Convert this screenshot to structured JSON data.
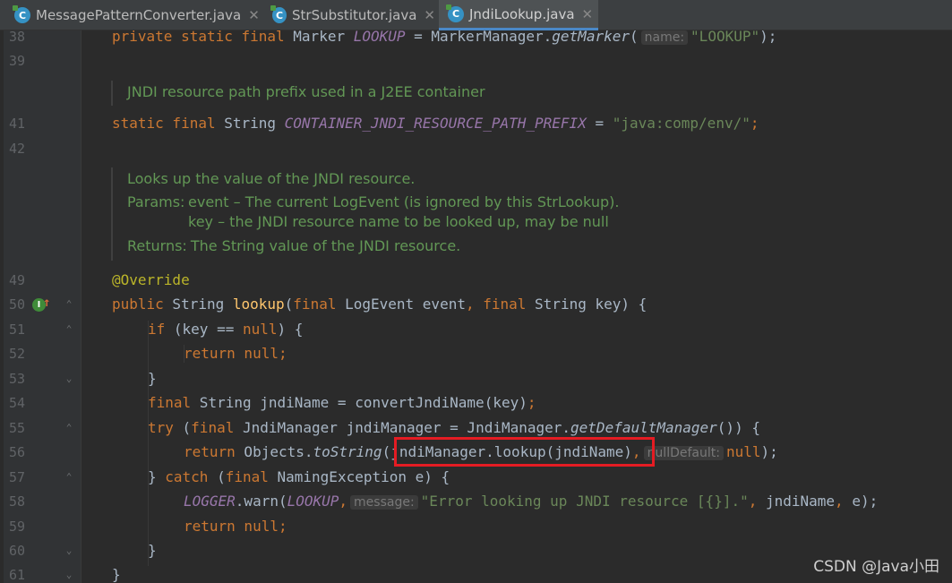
{
  "tabs": [
    {
      "label": "MessagePatternConverter.java",
      "icon": "java-class-icon",
      "active": false
    },
    {
      "label": "StrSubstitutor.java",
      "icon": "java-class-icon",
      "active": false
    },
    {
      "label": "JndiLookup.java",
      "icon": "java-class-icon",
      "active": true
    }
  ],
  "tab_icon_letter": "C",
  "close_glyph": "✕",
  "line_numbers": [
    "38",
    "39",
    "41",
    "42",
    "49",
    "50",
    "51",
    "52",
    "53",
    "54",
    "55",
    "56",
    "57",
    "58",
    "59",
    "60",
    "61"
  ],
  "doc1": "JNDI resource path prefix used in a J2EE container",
  "doc2": {
    "summary": "Looks up the value of the JNDI resource.",
    "params_label": "Params:",
    "param1": "event – The current LogEvent (is ignored by this StrLookup).",
    "param2": "key – the JNDI resource name to be looked up, may be null",
    "returns_label": "Returns:",
    "returns": "The String value of the JNDI resource."
  },
  "hints": {
    "name": "name:",
    "nullDefault": "nullDefault:",
    "message": "message:"
  },
  "code": {
    "l38_a": "private static final",
    "l38_b": " Marker ",
    "l38_c": "LOOKUP",
    "l38_d": " = MarkerManager.",
    "l38_e": "getMarker",
    "l38_f": "(",
    "l38_g": "\"LOOKUP\"",
    "l38_h": ");",
    "l41_a": "static final",
    "l41_b": " String ",
    "l41_c": "CONTAINER_JNDI_RESOURCE_PATH_PREFIX",
    "l41_d": " = ",
    "l41_e": "\"java:comp/env/\"",
    "l41_f": ";",
    "l49": "@Override",
    "l50_a": "public",
    "l50_b": " String ",
    "l50_c": "lookup",
    "l50_d": "(",
    "l50_e": "final",
    "l50_f": " LogEvent event",
    "l50_g": ", ",
    "l50_h": "final",
    "l50_i": " String key) {",
    "l51_a": "if",
    "l51_b": " (key == ",
    "l51_c": "null",
    "l51_d": ") {",
    "l52_a": "return null",
    "l52_b": ";",
    "l53": "}",
    "l54_a": "final",
    "l54_b": " String jndiName = convertJndiName(key)",
    "l54_c": ";",
    "l55_a": "try",
    "l55_b": " (",
    "l55_c": "final",
    "l55_d": " JndiManager jndiManager = JndiManager.",
    "l55_e": "getDefaultManager",
    "l55_f": "()) {",
    "l56_a": "return",
    "l56_b": " Objects.",
    "l56_c": "toString",
    "l56_d": "(jndiManager.lookup(jndiName)",
    "l56_e": ",",
    "l56_f": "null",
    "l56_g": ");",
    "l57_a": "} ",
    "l57_b": "catch",
    "l57_c": " (",
    "l57_d": "final",
    "l57_e": " NamingException e) {",
    "l58_a": "LOGGER",
    "l58_b": ".warn(",
    "l58_c": "LOOKUP",
    "l58_d": ",",
    "l58_e": "\"Error looking up JNDI resource [{}].\"",
    "l58_f": ", ",
    "l58_g": "jndiName",
    "l58_h": ", ",
    "l58_i": "e",
    "l58_j": ");",
    "l59_a": "return null",
    "l59_b": ";",
    "l60": "}",
    "l61": "}"
  },
  "watermark": "CSDN @Java小田",
  "colors": {
    "background": "#2b2b2b",
    "keyword": "#cc7832",
    "string": "#6a8759",
    "function": "#ffc66d",
    "constant": "#9876aa",
    "doc": "#629755",
    "highlight_box": "#e51c23"
  }
}
